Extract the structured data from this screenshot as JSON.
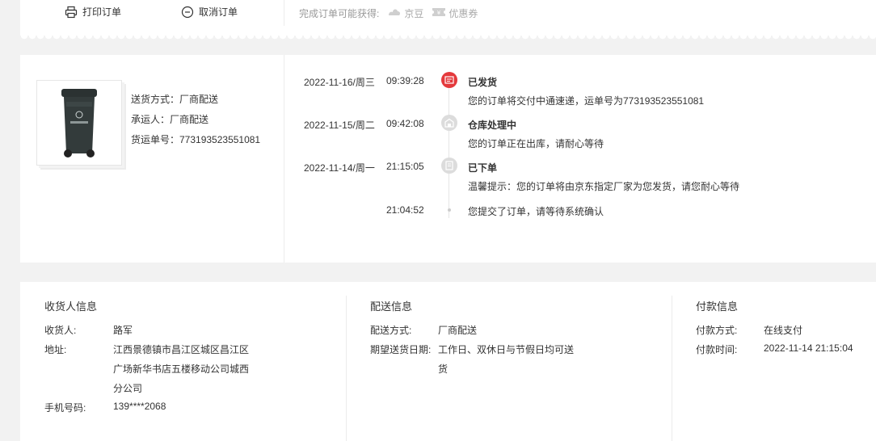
{
  "top": {
    "print_label": "打印订单",
    "cancel_label": "取消订单",
    "reward_prefix": "完成订单可能获得:",
    "reward_jingdou": "京豆",
    "reward_coupon": "优惠券"
  },
  "ship": {
    "method": "送货方式：厂商配送",
    "carrier": "承运人：厂商配送",
    "tracking": "货运单号：773193523551081"
  },
  "timeline": [
    {
      "date": "2022-11-16/周三",
      "time": "09:39:28",
      "status": "已发货",
      "desc": "您的订单将交付中通速递，运单号为773193523551081"
    },
    {
      "date": "2022-11-15/周二",
      "time": "09:42:08",
      "status": "仓库处理中",
      "desc": "您的订单正在出库，请耐心等待"
    },
    {
      "date": "2022-11-14/周一",
      "time": "21:15:05",
      "status": "已下单",
      "desc": "温馨提示：您的订单将由京东指定厂家为您发货，请您耐心等待"
    },
    {
      "date": "",
      "time": "21:04:52",
      "status": "",
      "desc": "您提交了订单，请等待系统确认"
    }
  ],
  "consignee": {
    "title": "收货人信息",
    "name_label": "收货人:",
    "name": "路军",
    "address_label": "地址:",
    "address_lines": [
      "江西景德镇市昌江区城区昌江区",
      "广场新华书店五楼移动公司城西",
      "分公司"
    ],
    "phone_label": "手机号码:",
    "phone": "139****2068"
  },
  "delivery": {
    "title": "配送信息",
    "method_label": "配送方式:",
    "method": "厂商配送",
    "date_label": "期望送货日期:",
    "date_lines": [
      "工作日、双休日与节假日均可送",
      "货"
    ]
  },
  "payment": {
    "title": "付款信息",
    "method_label": "付款方式:",
    "method": "在线支付",
    "time_label": "付款时间:",
    "time": "2022-11-14 21:15:04"
  },
  "colors": {
    "accent": "#e4393c",
    "icon_gray": "#d8d8d8",
    "text": "#333333",
    "muted": "#999999"
  }
}
